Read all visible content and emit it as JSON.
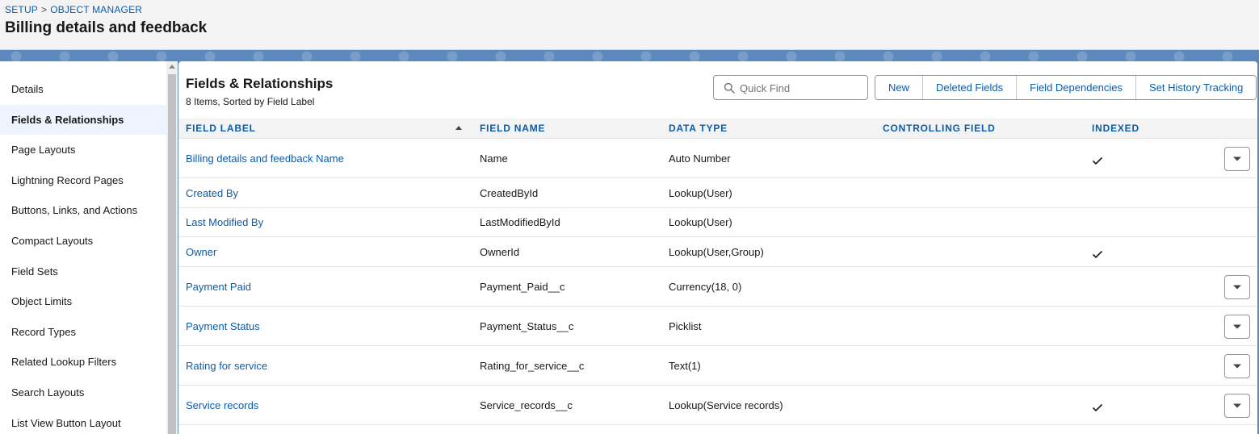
{
  "breadcrumb": {
    "setup": "SETUP",
    "separator": ">",
    "object_manager": "OBJECT MANAGER"
  },
  "header": {
    "title": "Billing details and feedback"
  },
  "sidebar": {
    "items": [
      {
        "label": "Details"
      },
      {
        "label": "Fields & Relationships"
      },
      {
        "label": "Page Layouts"
      },
      {
        "label": "Lightning Record Pages"
      },
      {
        "label": "Buttons, Links, and Actions"
      },
      {
        "label": "Compact Layouts"
      },
      {
        "label": "Field Sets"
      },
      {
        "label": "Object Limits"
      },
      {
        "label": "Record Types"
      },
      {
        "label": "Related Lookup Filters"
      },
      {
        "label": "Search Layouts"
      },
      {
        "label": "List View Button Layout"
      }
    ],
    "active_index": 1
  },
  "main": {
    "title": "Fields & Relationships",
    "subtitle": "8 Items, Sorted by Field Label",
    "search": {
      "placeholder": "Quick Find",
      "icon": "search-icon"
    },
    "buttons": {
      "new": "New",
      "deleted_fields": "Deleted Fields",
      "field_dependencies": "Field Dependencies",
      "set_history_tracking": "Set History Tracking"
    },
    "table": {
      "headers": {
        "field_label": "FIELD LABEL",
        "field_name": "FIELD NAME",
        "data_type": "DATA TYPE",
        "controlling_field": "CONTROLLING FIELD",
        "indexed": "INDEXED"
      },
      "sort_icon": "sort-ascending-icon",
      "rows": [
        {
          "label": "Billing details and feedback Name",
          "name": "Name",
          "type": "Auto Number",
          "controlling": "",
          "indexed": true,
          "menu": true
        },
        {
          "label": "Created By",
          "name": "CreatedById",
          "type": "Lookup(User)",
          "controlling": "",
          "indexed": false,
          "menu": false
        },
        {
          "label": "Last Modified By",
          "name": "LastModifiedById",
          "type": "Lookup(User)",
          "controlling": "",
          "indexed": false,
          "menu": false
        },
        {
          "label": "Owner",
          "name": "OwnerId",
          "type": "Lookup(User,Group)",
          "controlling": "",
          "indexed": true,
          "menu": false
        },
        {
          "label": "Payment Paid",
          "name": "Payment_Paid__c",
          "type": "Currency(18, 0)",
          "controlling": "",
          "indexed": false,
          "menu": true
        },
        {
          "label": "Payment Status",
          "name": "Payment_Status__c",
          "type": "Picklist",
          "controlling": "",
          "indexed": false,
          "menu": true
        },
        {
          "label": "Rating for service",
          "name": "Rating_for_service__c",
          "type": "Text(1)",
          "controlling": "",
          "indexed": false,
          "menu": true
        },
        {
          "label": "Service records",
          "name": "Service_records__c",
          "type": "Lookup(Service records)",
          "controlling": "",
          "indexed": true,
          "menu": true
        }
      ]
    }
  },
  "colors": {
    "link": "#0b5cab",
    "header_bg": "#f3f3f3",
    "band": "#5b88bd",
    "active_item_bg": "#eef4ff"
  }
}
